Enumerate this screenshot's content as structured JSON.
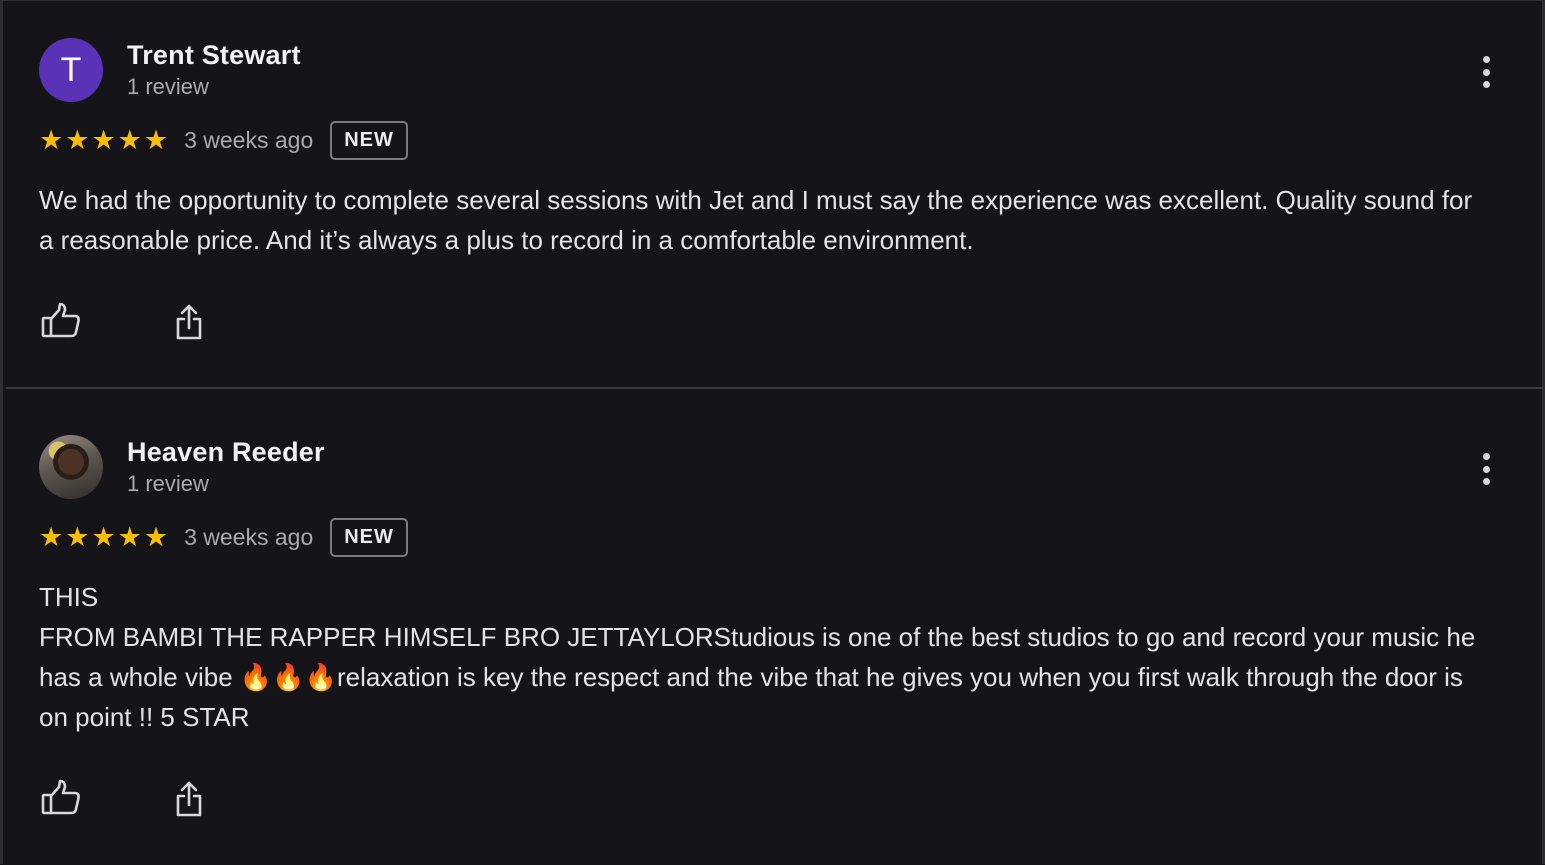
{
  "colors": {
    "background": "#151519",
    "star": "#fbbc04",
    "avatar_trent": "#5a32b6",
    "divider": "#3a3a40"
  },
  "reviews": [
    {
      "avatar_letter": "T",
      "name": "Trent Stewart",
      "review_count": "1 review",
      "rating": 5,
      "stars": [
        "★",
        "★",
        "★",
        "★",
        "★"
      ],
      "time": "3 weeks ago",
      "badge": "NEW",
      "text_lines": [
        "We had the opportunity to complete several sessions with Jet and I must say the experience was excellent. Quality sound for a reasonable price. And it’s always a plus to record in a comfortable environment."
      ]
    },
    {
      "avatar_letter": "",
      "name": "Heaven Reeder",
      "review_count": "1 review",
      "rating": 5,
      "stars": [
        "★",
        "★",
        "★",
        "★",
        "★"
      ],
      "time": "3 weeks ago",
      "badge": "NEW",
      "text_lines": [
        "THIS",
        "FROM BAMBI THE RAPPER HIMSELF BRO JETTAYLORStudious is one of the best studios to go and record your music he has a whole vibe 🔥🔥🔥relaxation is key the respect and the vibe that he gives you when you first walk through the door is on point !! 5 STAR"
      ]
    }
  ],
  "icons": {
    "like": "thumbs-up-icon",
    "share": "share-icon",
    "more": "more-vert-icon"
  }
}
